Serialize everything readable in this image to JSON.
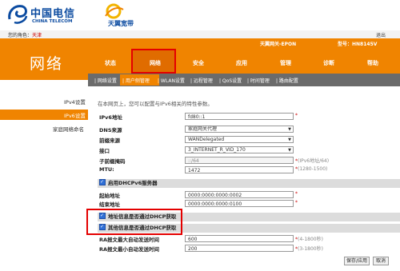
{
  "header": {
    "brand_cn": "中国电信",
    "brand_en": "CHINA TELECOM",
    "tianyi": "天翼宽带",
    "welcome_prefix": "您的角色：",
    "welcome_role": "天津",
    "exit": "退出",
    "device": "天翼网关-EPON",
    "model": "型号：HN8145V"
  },
  "page_title": "网络",
  "nav": [
    "状态",
    "网络",
    "安全",
    "应用",
    "管理",
    "诊断",
    "帮助"
  ],
  "subnav": [
    "| 网络设置",
    "| 用户侧管理",
    "| WLAN设置",
    "| 远程管理",
    "| QoS设置",
    "| 时间管理",
    "| 路由配置"
  ],
  "sidebar": [
    "IPv4设置",
    "IPv6设置",
    "家庭网络命名"
  ],
  "intro": "在本网页上，您可以配置与IPv6相关的特性参数。",
  "form": {
    "ipv6_addr_label": "IPv6地址",
    "ipv6_addr_value": "fd80::1",
    "dns_source_label": "DNS来源",
    "dns_source_value": "家庭网关代理",
    "prefix_source_label": "前缀来源",
    "prefix_source_value": "WANDelegated",
    "interface_label": "接口",
    "interface_value": "3_INTERNET_R_VID_170",
    "subnet_prefix_label": "子前缀掩码",
    "subnet_prefix_value": "::/64",
    "subnet_prefix_hint": "(IPv6地址/64)",
    "mtu_label": "MTU:",
    "mtu_value": "1472",
    "mtu_hint": "(1280-1500)",
    "dhcp_section": "启用DHCPv6服务器",
    "start_label": "起始地址",
    "start_value": "0000:0000:0000:0002",
    "end_label": "结束地址",
    "end_value": "0000:0000:0000:0100",
    "addr_dhcp_label": "地址信息是否通过DHCP获取",
    "other_dhcp_label": "其他信息是否通过DHCP获取",
    "ra_max_label": "RA报文最大自动发送时间",
    "ra_max_value": "600",
    "ra_max_hint": "(4-1800秒)",
    "ra_min_label": "RA报文最小自动发送时间",
    "ra_min_value": "200",
    "ra_min_hint": "(3-1800秒)",
    "required_mark": "*"
  },
  "buttons": {
    "apply": "保存/应用",
    "cancel": "取消"
  }
}
